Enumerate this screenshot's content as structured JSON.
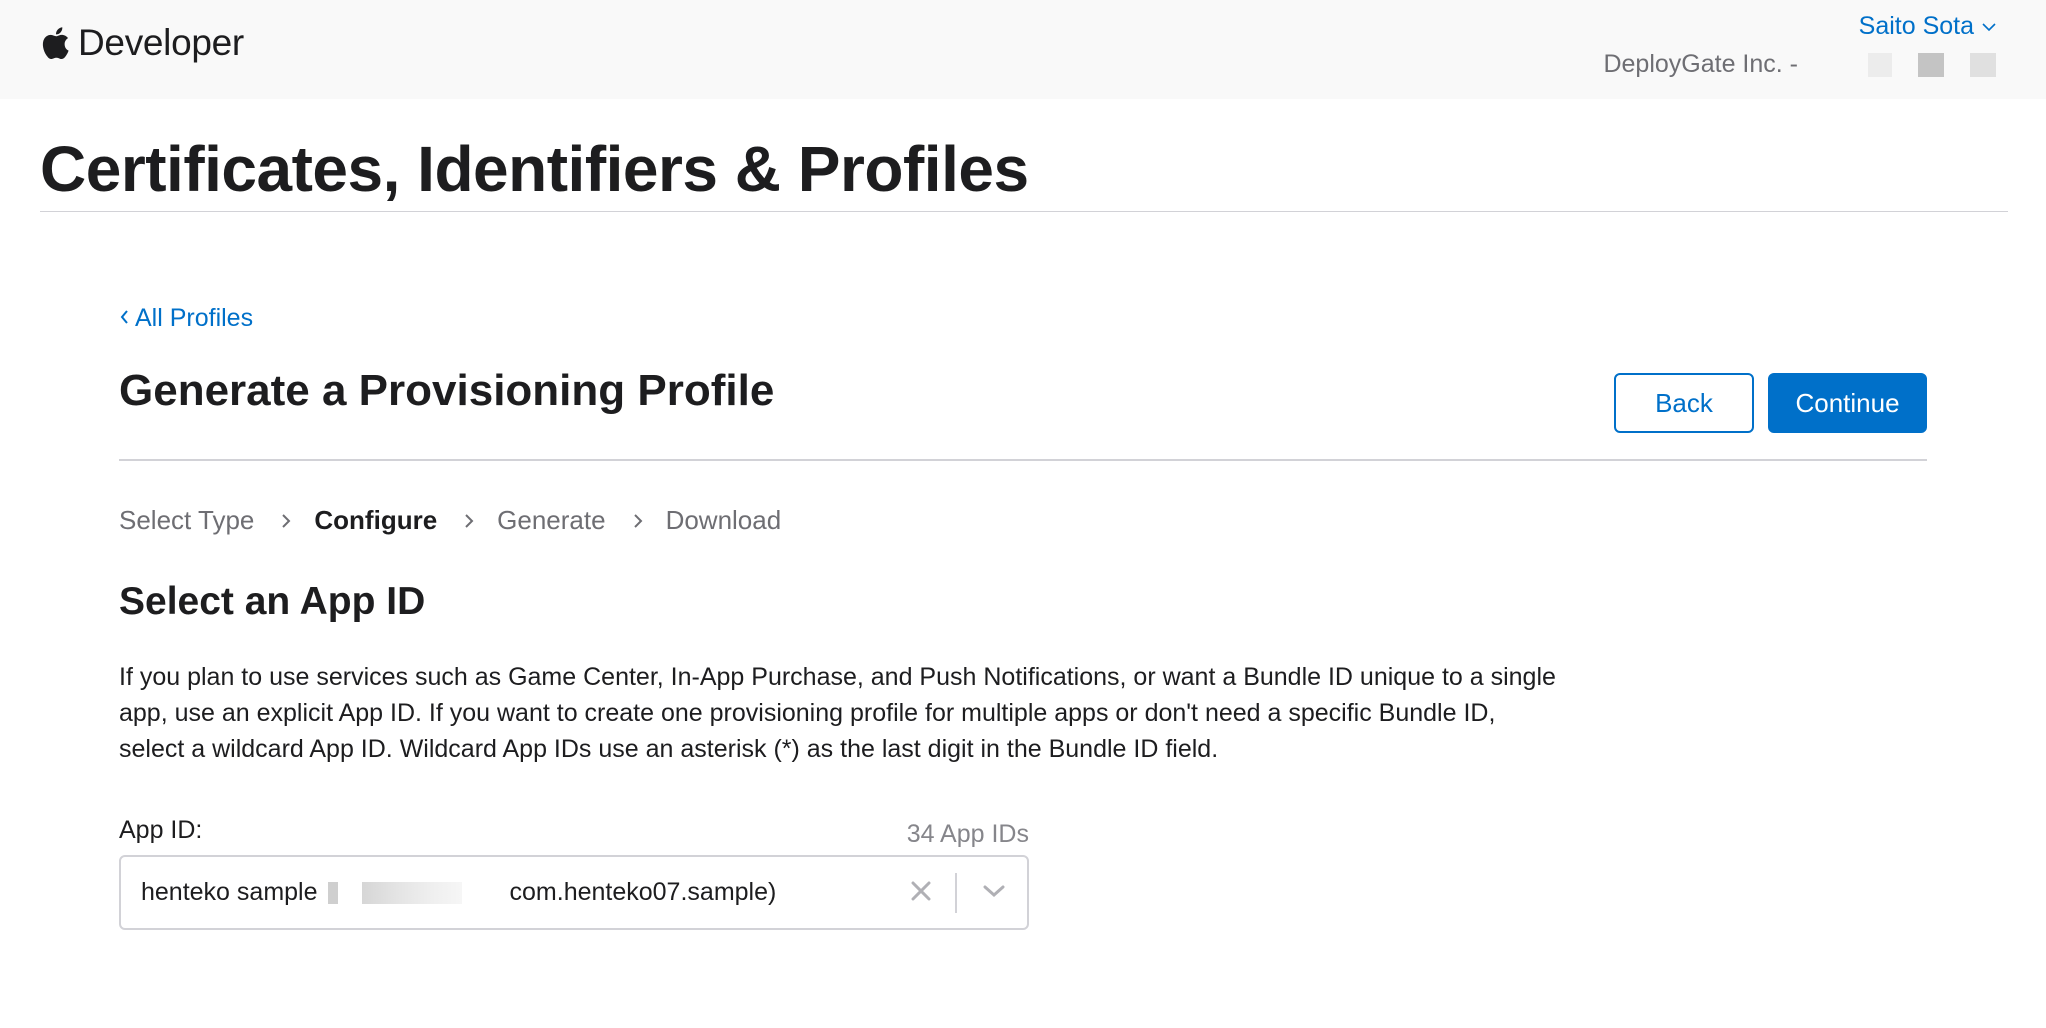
{
  "header": {
    "brand_text": "Developer",
    "account_name": "Saito Sota",
    "team_name": "DeployGate Inc. -"
  },
  "page": {
    "title": "Certificates, Identifiers & Profiles"
  },
  "breadcrumb": {
    "label": "All Profiles"
  },
  "section": {
    "title": "Generate a Provisioning Profile",
    "back_label": "Back",
    "continue_label": "Continue"
  },
  "steps": [
    {
      "label": "Select Type",
      "active": false
    },
    {
      "label": "Configure",
      "active": true
    },
    {
      "label": "Generate",
      "active": false
    },
    {
      "label": "Download",
      "active": false
    }
  ],
  "app_id": {
    "title": "Select an App ID",
    "description": "If you plan to use services such as Game Center, In-App Purchase, and Push Notifications, or want a Bundle ID unique to a single app, use an explicit App ID. If you want to create one provisioning profile for multiple apps or don't need a specific Bundle ID, select a wildcard App ID. Wildcard App IDs use an asterisk (*) as the last digit in the Bundle ID field.",
    "field_label": "App ID:",
    "count_label": "34 App IDs",
    "selected_name": "henteko sample",
    "selected_bundle": "com.henteko07.sample)"
  },
  "icons": {
    "brand": "apple-logo-icon",
    "account": "chevron-down-icon",
    "breadcrumb": "chevron-left-icon",
    "step_separator": "chevron-right-icon",
    "clear": "close-icon",
    "dropdown": "chevron-down-icon"
  },
  "colors": {
    "accent": "#0070c9",
    "topbar_bg": "#f9f9f9",
    "text": "#1d1d1f",
    "muted": "#6e6e73",
    "border": "#d2d2d7"
  }
}
